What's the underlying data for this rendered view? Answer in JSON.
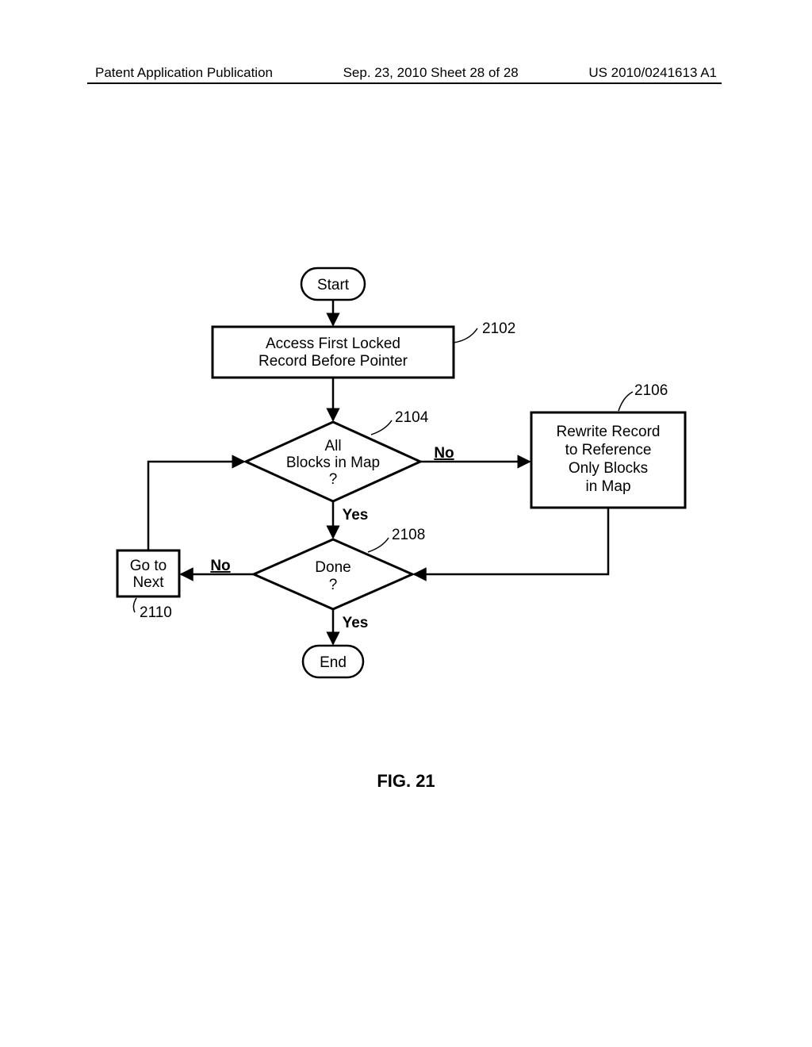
{
  "header": {
    "left": "Patent Application Publication",
    "mid": "Sep. 23, 2010  Sheet 28 of 28",
    "right": "US 2010/0241613 A1"
  },
  "flow": {
    "start": "Start",
    "end": "End",
    "box_2102": "Access First Locked\nRecord Before Pointer",
    "dec_2104": "All\nBlocks in Map\n?",
    "dec_2108": "Done\n?",
    "box_2106": "Rewrite Record\nto Reference\nOnly Blocks\nin Map",
    "box_2110": "Go to\nNext",
    "yes": "Yes",
    "no": "No",
    "ref_2102": "2102",
    "ref_2104": "2104",
    "ref_2106": "2106",
    "ref_2108": "2108",
    "ref_2110": "2110"
  },
  "figure_caption": "FIG. 21"
}
